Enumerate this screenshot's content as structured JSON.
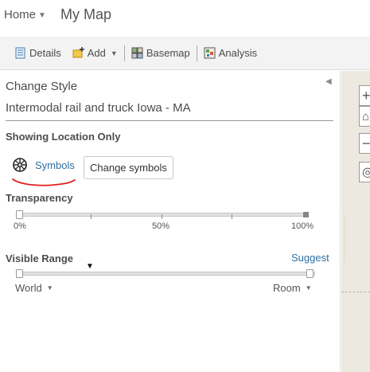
{
  "header": {
    "home_label": "Home",
    "map_title": "My Map"
  },
  "toolbar": {
    "details_label": "Details",
    "add_label": "Add",
    "basemap_label": "Basemap",
    "analysis_label": "Analysis"
  },
  "panel": {
    "title": "Change Style",
    "layer_name": "Intermodal rail and truck Iowa - MA",
    "showing_label": "Showing Location Only",
    "symbols_link": "Symbols",
    "change_symbols_button": "Change symbols",
    "transparency": {
      "label": "Transparency",
      "value_percent": 0,
      "tick_labels": [
        "0%",
        "50%",
        "100%"
      ]
    },
    "visible_range": {
      "label": "Visible Range",
      "suggest_label": "Suggest",
      "min_label": "World",
      "max_label": "Room"
    }
  },
  "map": {
    "controls": [
      "+",
      "⌂",
      "−",
      "◎"
    ]
  },
  "colors": {
    "accent": "#2d6fa3",
    "annotation_red": "#e02020",
    "toolbar_bg": "#f3f3f3"
  }
}
